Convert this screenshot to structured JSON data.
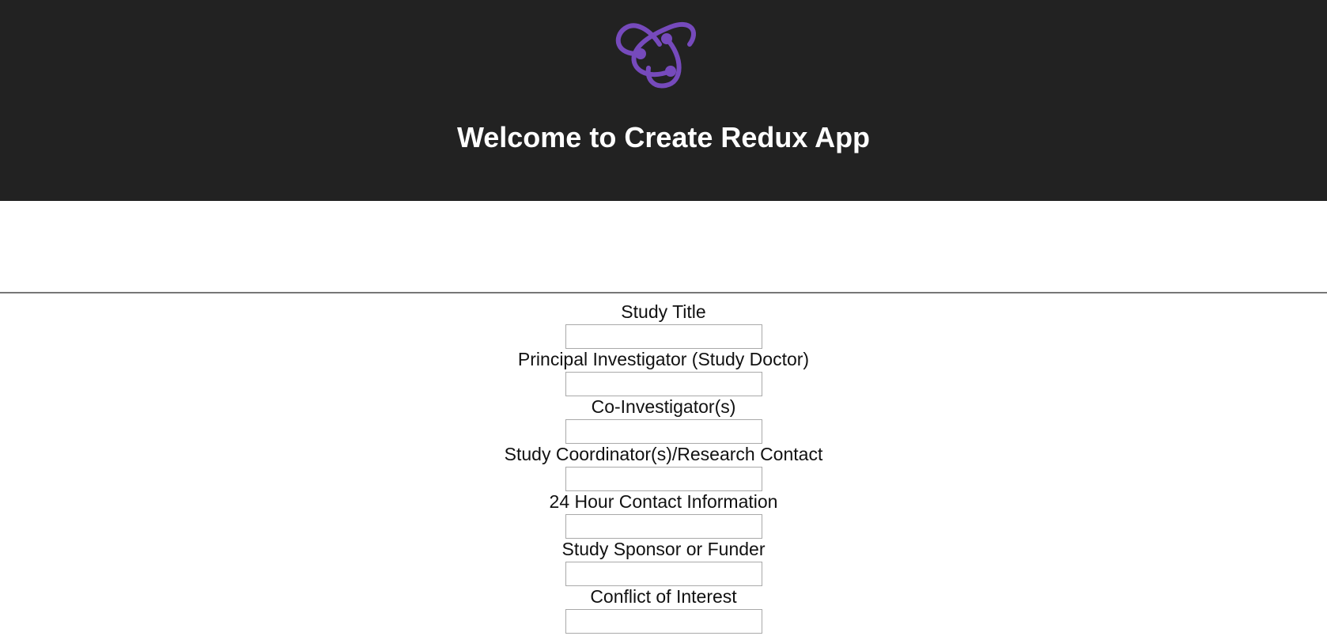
{
  "header": {
    "logo_icon": "redux-logo-icon",
    "logo_color": "#764abc",
    "title": "Welcome to Create Redux App"
  },
  "form": {
    "fields": [
      {
        "label": "Study Title",
        "value": "",
        "placeholder": ""
      },
      {
        "label": "Principal Investigator (Study Doctor)",
        "value": "",
        "placeholder": ""
      },
      {
        "label": "Co-Investigator(s)",
        "value": "",
        "placeholder": ""
      },
      {
        "label": "Study Coordinator(s)/Research Contact",
        "value": "",
        "placeholder": ""
      },
      {
        "label": "24 Hour Contact Information",
        "value": "",
        "placeholder": ""
      },
      {
        "label": "Study Sponsor or Funder",
        "value": "",
        "placeholder": ""
      },
      {
        "label": "Conflict of Interest",
        "value": "",
        "placeholder": ""
      }
    ]
  }
}
